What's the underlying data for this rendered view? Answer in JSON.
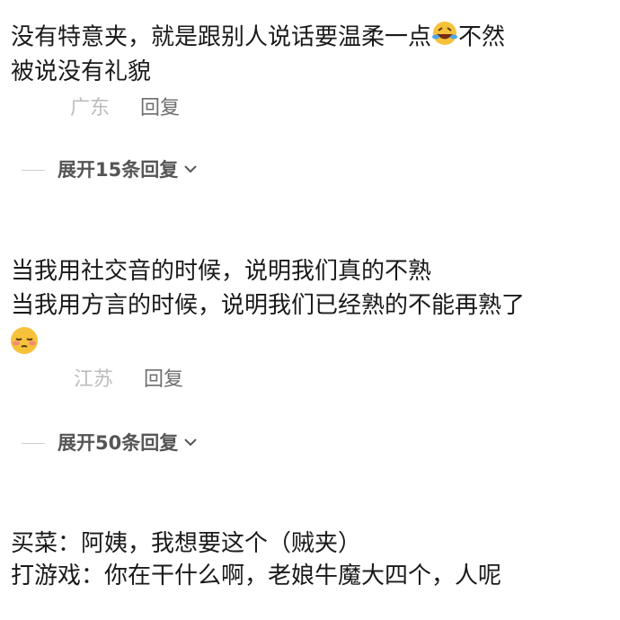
{
  "comment1": {
    "line1_before": "没有特意夹，就是跟别人说话要温柔一点",
    "line1_after": "不然",
    "line2": "被说没有礼貌",
    "emoji": "rofl-emoji",
    "location": "广东",
    "reply": "回复",
    "expand": "展开15条回复"
  },
  "comment2": {
    "line1": "当我用社交音的时候，说明我们真的不熟",
    "line2": "当我用方言的时候，说明我们已经熟的不能再熟了",
    "emoji": "pensive-emoji",
    "location": "江苏",
    "reply": "回复",
    "expand": "展开50条回复"
  },
  "snippet": {
    "line1": "买菜：阿姨，我想要这个（贼夹）",
    "line2": "打游戏：你在干什么啊，老娘牛魔大四个，人呢"
  },
  "icons": {
    "expand_chevron": "chevron-down-icon"
  }
}
